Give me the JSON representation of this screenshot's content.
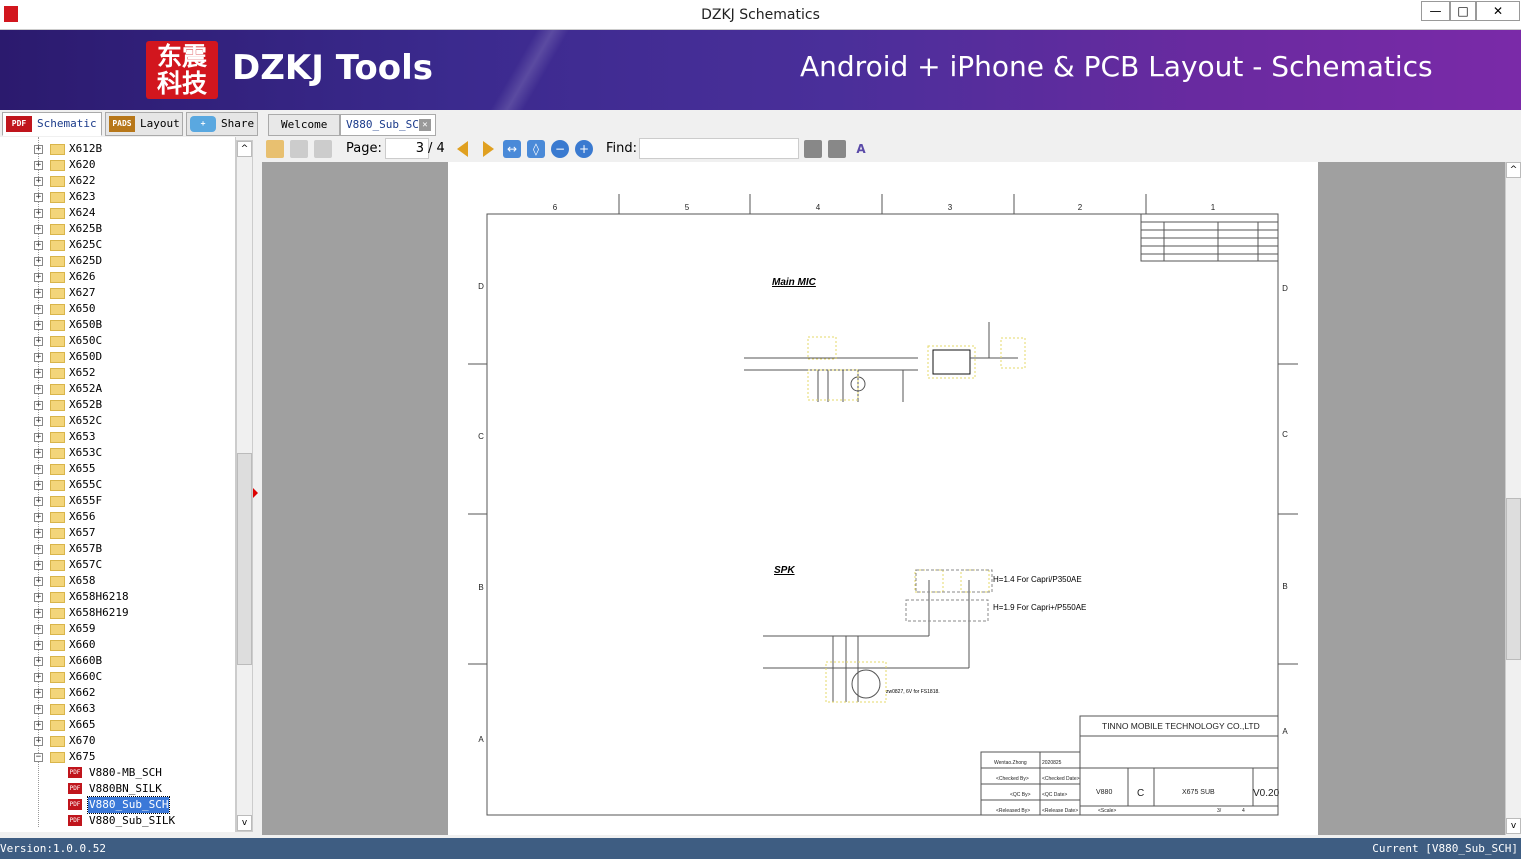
{
  "window": {
    "title": "DZKJ Schematics",
    "minimize": "—",
    "maximize": "□",
    "close": "✕"
  },
  "banner": {
    "logo": "东震科技",
    "brand": "DZKJ Tools",
    "slogan": "Android + iPhone & PCB Layout - Schematics"
  },
  "left_tabs": [
    {
      "label": "Schematic",
      "icon": "PDF"
    },
    {
      "label": "Layout",
      "icon": "PADS"
    },
    {
      "label": "Share",
      "icon": "+"
    }
  ],
  "doc_tabs": [
    {
      "label": "Welcome"
    },
    {
      "label": "V880_Sub_SCH"
    }
  ],
  "toolbar": {
    "page_label": "Page:",
    "page_value": "3",
    "page_total": "/ 4",
    "find_label": "Find:",
    "find_value": ""
  },
  "tree": {
    "folders": [
      "X612B",
      "X620",
      "X622",
      "X623",
      "X624",
      "X625B",
      "X625C",
      "X625D",
      "X626",
      "X627",
      "X650",
      "X650B",
      "X650C",
      "X650D",
      "X652",
      "X652A",
      "X652B",
      "X652C",
      "X653",
      "X653C",
      "X655",
      "X655C",
      "X655F",
      "X656",
      "X657",
      "X657B",
      "X657C",
      "X658",
      "X658H6218",
      "X658H6219",
      "X659",
      "X660",
      "X660B",
      "X660C",
      "X662",
      "X663",
      "X665",
      "X670",
      "X675"
    ],
    "files": [
      "V880-MB_SCH",
      "V880BN_SILK",
      "V880_Sub_SCH",
      "V880_Sub_SILK"
    ],
    "selected": "V880_Sub_SCH"
  },
  "schematic": {
    "columns": [
      "6",
      "5",
      "4",
      "3",
      "2",
      "1"
    ],
    "rows": [
      "D",
      "C",
      "B",
      "A"
    ],
    "main_mic": "Main MIC",
    "spk": "SPK",
    "spk_note1": "H=1.4  For Capri/P350AE",
    "spk_note2": "H=1.9  For Capri+/P550AE",
    "spk_note3": "zw0827, 6V for FS1818.",
    "title_block": {
      "company": "TINNO MOBILE TECHNOLOGY CO.,LTD",
      "drawn": "Wentao.Zhong",
      "date": "2020825",
      "checked": "<Checked By>",
      "checked_date": "<Checked Date>",
      "qc": "<QC By>",
      "qc_date": "<QC Date>",
      "released": "<Released By>",
      "release_date": "<Release Date>",
      "code": "V880",
      "size": "C",
      "drawing_no": "X675 SUB",
      "rev": "V0.20",
      "scale": "<Scale>",
      "sheet": "3/",
      "sheet_total": "4"
    }
  },
  "status": {
    "version": "Version:1.0.0.52",
    "current": "Current [V880_Sub_SCH]"
  }
}
